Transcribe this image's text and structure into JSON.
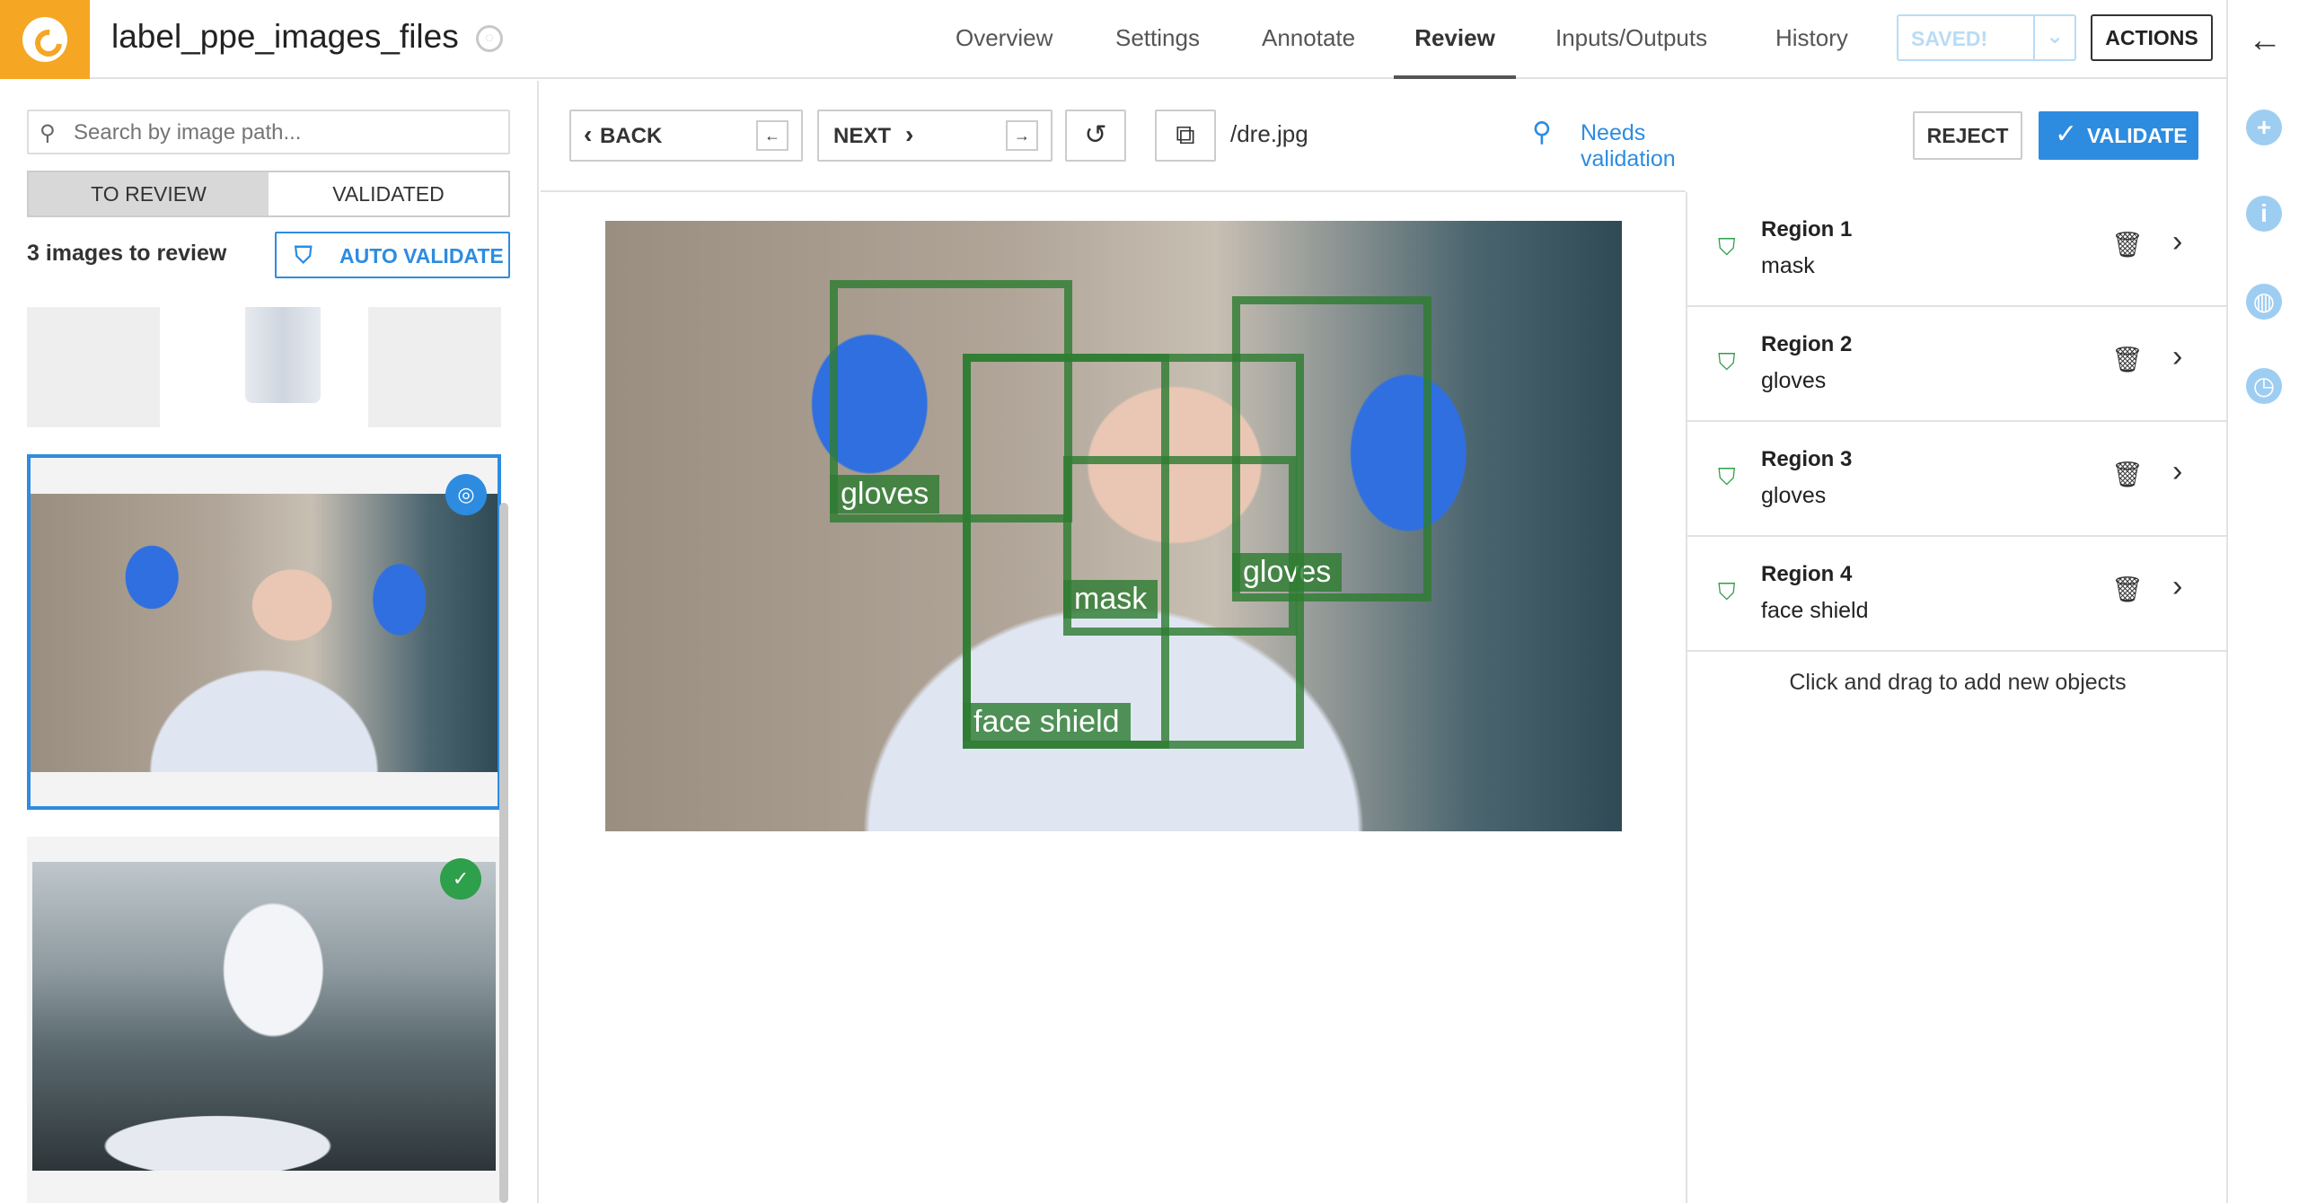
{
  "app": {
    "title": "label_ppe_images_files",
    "nav": [
      "Overview",
      "Settings",
      "Annotate",
      "Review",
      "Inputs/Outputs",
      "History"
    ],
    "active_tab": "Review",
    "saved_label": "SAVED!",
    "actions_label": "ACTIONS"
  },
  "left": {
    "search_placeholder": "Search by image path...",
    "tabs": [
      "TO REVIEW",
      "VALIDATED"
    ],
    "count_text": "3 images to review",
    "auto_validate_label": "AUTO VALIDATE"
  },
  "toolbar": {
    "back_label": "BACK",
    "back_key": "←",
    "next_label": "NEXT",
    "next_key": "→",
    "path": "/dre.jpg",
    "status": "Needs validation",
    "reject_label": "REJECT",
    "validate_label": "VALIDATE"
  },
  "annotations": [
    "gloves",
    "mask",
    "gloves",
    "face shield"
  ],
  "regions": [
    {
      "name": "Region 1",
      "cls": "mask"
    },
    {
      "name": "Region 2",
      "cls": "gloves"
    },
    {
      "name": "Region 3",
      "cls": "gloves"
    },
    {
      "name": "Region 4",
      "cls": "face shield"
    }
  ],
  "hint": "Click and drag to add new objects",
  "icons": {
    "search": "search-icon",
    "auto_validate": "validate-shield-icon",
    "undo": "undo-icon",
    "copy": "copy-icon",
    "needs_validation": "needs-validation-icon",
    "check": "check-icon",
    "delete": "trash-icon",
    "chevron": "chevron-right-icon",
    "back_arrow": "arrow-left-icon"
  },
  "colors": {
    "accent": "#2d8ce0",
    "brand": "#f5a623",
    "annotation": "#2e7d32"
  }
}
